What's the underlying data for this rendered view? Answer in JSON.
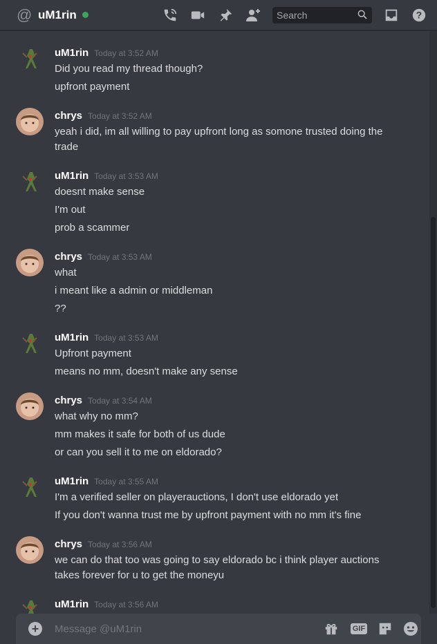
{
  "header": {
    "title": "uM1rin",
    "search_placeholder": "Search",
    "icons": [
      "at-icon",
      "online-status",
      "call-icon",
      "video-icon",
      "pin-icon",
      "add-friend-icon",
      "search-icon",
      "inbox-icon",
      "help-icon"
    ]
  },
  "messages": [
    {
      "author": "uM1rin",
      "time": "Today at 3:52 AM",
      "lines": [
        "Did you read my thread though?",
        "upfront payment"
      ]
    },
    {
      "author": "chrys",
      "time": "Today at 3:52 AM",
      "lines": [
        "yeah i did, im all willing to pay upfront long as somone trusted doing the",
        "trade"
      ]
    },
    {
      "author": "uM1rin",
      "time": "Today at 3:53 AM",
      "lines": [
        "doesnt make sense",
        "I'm out",
        "prob a scammer"
      ]
    },
    {
      "author": "chrys",
      "time": "Today at 3:53 AM",
      "lines": [
        "what",
        "i meant like a admin or middleman",
        "??"
      ]
    },
    {
      "author": "uM1rin",
      "time": "Today at 3:53 AM",
      "lines": [
        "Upfront payment",
        "means no mm, doesn't make any sense"
      ]
    },
    {
      "author": "chrys",
      "time": "Today at 3:54 AM",
      "lines": [
        "what why no mm?",
        "mm makes it safe for both of us dude",
        "or can you sell it to me on eldorado?"
      ]
    },
    {
      "author": "uM1rin",
      "time": "Today at 3:55 AM",
      "lines": [
        "I'm a verified seller on playerauctions, I don't use eldorado yet",
        "If you don't wanna trust me by upfront payment with no mm it's fine"
      ]
    },
    {
      "author": "chrys",
      "time": "Today at 3:56 AM",
      "lines": [
        "we can do that too was going to say eldorado bc i think player auctions",
        "takes forever for u to get the moneyu"
      ]
    },
    {
      "author": "uM1rin",
      "time": "Today at 3:56 AM",
      "lines": []
    }
  ],
  "composer": {
    "placeholder": "Message @uM1rin",
    "gif_label": "GIF",
    "icons": [
      "add-attachment-icon",
      "gift-icon",
      "gif-icon",
      "sticker-icon",
      "emoji-icon"
    ]
  },
  "colors": {
    "background": "#36393f",
    "online": "#3ba55c",
    "author": "#ffffff",
    "text": "#dcddde",
    "timestamp": "#72767d"
  }
}
